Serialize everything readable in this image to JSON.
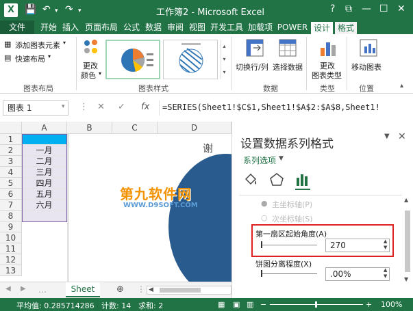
{
  "window": {
    "title": "工作簿2 - Microsoft Excel",
    "help": "?",
    "ribbon_display": "⧉",
    "minimize": "—",
    "restore": "☐",
    "close": "✕",
    "app_icon": "X"
  },
  "tabs": [
    "文件",
    "开始",
    "插入",
    "页面布局",
    "公式",
    "数据",
    "审阅",
    "视图",
    "开发工具",
    "加载项",
    "POWER",
    "设计",
    "格式"
  ],
  "ribbon": {
    "add_element": "添加图表元素",
    "quick_layout": "快速布局",
    "change_colors_1": "更改",
    "change_colors_2": "颜色",
    "switch_row_col": "切换行/列",
    "select_data": "选择数据",
    "change_type_1": "更改",
    "change_type_2": "图表类型",
    "move_chart": "移动图表",
    "groups": {
      "layout": "图表布局",
      "styles": "图表样式",
      "data": "数据",
      "type": "类型",
      "location": "位置"
    }
  },
  "formula_bar": {
    "name_box": "图表 1",
    "formula": "=SERIES(Sheet1!$C$1,Sheet1!$A$2:$A$8,Sheet1!"
  },
  "grid": {
    "columns": [
      "A",
      "B",
      "C",
      "D"
    ],
    "rows": [
      "1",
      "2",
      "3",
      "4",
      "5",
      "6",
      "7",
      "8",
      "9",
      "10",
      "11",
      "12",
      "13"
    ],
    "a_values": [
      "",
      "一月",
      "二月",
      "三月",
      "四月",
      "五月",
      "六月"
    ],
    "chart_title_fragment": "谢"
  },
  "sheets": {
    "active": "Sheet"
  },
  "pane": {
    "title": "设置数据系列格式",
    "series_options": "系列选项",
    "primary_axis": "主坐标轴(P)",
    "secondary_axis": "次坐标轴(S)",
    "first_slice_label": "第一扇区起始角度(A)",
    "first_slice_value": "270",
    "explosion_label": "饼图分离程度(X)",
    "explosion_value": ".00%"
  },
  "watermark": {
    "line1": "第九软件网",
    "line2": "WWW.D9SOFT.COM"
  },
  "status": {
    "average": "平均值: 0.285714286",
    "count": "计数: 14",
    "sum": "求和: 2",
    "zoom": "100%"
  }
}
